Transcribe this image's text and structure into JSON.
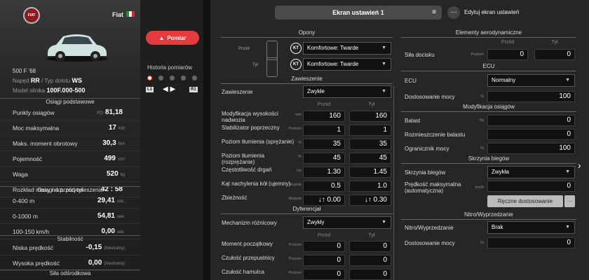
{
  "brand": "Fiat",
  "logo_text": "FIAT",
  "model": "500 F '68",
  "drive_label": "Napęd",
  "drive": "RR",
  "aspiration_label": "Typ dolotu",
  "aspiration": "WS",
  "engine_label": "Model silnika",
  "engine": "100F.000-500",
  "colors": {
    "accent": "#e23c3c",
    "flag_green": "#1e8f3a",
    "flag_white": "#f2f2f2",
    "flag_red": "#d7262e"
  },
  "sections": {
    "basic": "Osiągi podstawowe",
    "accel": "Osiągi dot. przyspieszenia",
    "stability": "Stabilność",
    "cornering": "Siła odśrodkowa"
  },
  "stats": [
    {
      "label": "Punkty osiągów",
      "prefix": "PO",
      "value": "81,18",
      "unit": "",
      "hist": "81,18"
    },
    {
      "label": "Moc maksymalna",
      "prefix": "",
      "value": "17",
      "unit": "KM",
      "hist": "17"
    },
    {
      "label": "Maks. moment obrotowy",
      "prefix": "",
      "value": "30,3",
      "unit": "Nm",
      "hist": "30,3"
    },
    {
      "label": "Pojemność",
      "prefix": "",
      "value": "499",
      "unit": "cm³",
      "hist": "499"
    },
    {
      "label": "Waga",
      "prefix": "",
      "value": "520",
      "unit": "kg",
      "hist": "520"
    },
    {
      "label": "Rozkład masy na przód-tył",
      "prefix": "",
      "value": "42 : 58",
      "unit": "",
      "hist": "42 : 58"
    }
  ],
  "accel": [
    {
      "label": "0-400 m",
      "value": "29,41",
      "unit": "sek.",
      "hist": "29,41"
    },
    {
      "label": "0-1000 m",
      "value": "54,81",
      "unit": "sek.",
      "hist": "54,81"
    },
    {
      "label": "100-150 km/h",
      "value": "0,00",
      "unit": "sek.",
      "hist": "0,00"
    }
  ],
  "stability": [
    {
      "label": "Niska prędkość",
      "value": "-0,15",
      "unit": "(Neutralny)",
      "hist": "-0,15"
    },
    {
      "label": "Wysoka prędkość",
      "value": "0,00",
      "unit": "(Neutralny)",
      "hist": "0,00"
    }
  ],
  "measure_button": "Pomiar",
  "history_label": "Historia pomiarów",
  "l1": "L1",
  "r1": "R1",
  "title": "Ekran ustawień 1",
  "edit_label": "Edytuj ekran ustawień",
  "edit_icon": "ellipsis-icon",
  "tires": {
    "header": "Opony",
    "front_label": "Przód",
    "rear_label": "Tył",
    "badge": "KT",
    "front": "Komfortowe: Twarde",
    "rear": "Komfortowe: Twarde"
  },
  "front_col": "Przód",
  "rear_col": "Tył",
  "suspension": {
    "header": "Zawieszenie",
    "label": "Zawieszenie",
    "value": "Zwykłe",
    "rows": [
      {
        "label": "Modyfikacja wysokości nadwozia",
        "unit": "mm",
        "front": "160",
        "rear": "160"
      },
      {
        "label": "Stabilizator poprzeczny",
        "unit": "Poziom",
        "front": "1",
        "rear": "1"
      },
      {
        "label": "Poziom tłumienia (sprężanie)",
        "unit": "%",
        "front": "35",
        "rear": "35"
      },
      {
        "label": "Poziom tłumienia (rozprężanie)",
        "unit": "%",
        "front": "45",
        "rear": "45"
      },
      {
        "label": "Częstotliwość drgań",
        "unit": "Hz",
        "front": "1.30",
        "rear": "1.45"
      },
      {
        "label": "Kąt nachylenia kół (ujemny)",
        "unit": "Stopnie",
        "front": "0.5",
        "rear": "1.0"
      },
      {
        "label": "Zbieżność",
        "unit": "Stopnie",
        "front": "↓↑ 0.00",
        "rear": "↓↑ 0.30"
      }
    ]
  },
  "diff": {
    "header": "Dyferencjał",
    "label": "Mechanizm różnicowy",
    "value": "Zwykły",
    "rows": [
      {
        "label": "Moment początkowy",
        "unit": "Poziom",
        "front": "0",
        "rear": "0"
      },
      {
        "label": "Czułość przepustnicy",
        "unit": "Poziom",
        "front": "0",
        "rear": "0"
      },
      {
        "label": "Czułość hamulca",
        "unit": "Poziom",
        "front": "0",
        "rear": "0"
      }
    ]
  },
  "aero": {
    "header": "Elementy aerodynamiczne",
    "label": "Siła docisku",
    "unit": "Poziom",
    "front": "0",
    "rear": "0"
  },
  "ecu": {
    "header": "ECU",
    "label": "ECU",
    "value": "Normalny",
    "power_label": "Dostosowanie mocy",
    "power_unit": "%",
    "power": "100"
  },
  "perf": {
    "header": "Modyfikacja osiągów",
    "ballast_label": "Balast",
    "ballast_unit": "kg",
    "ballast": "0",
    "pos_label": "Rozmieszczenie balastu",
    "pos": "0",
    "limit_label": "Ogranicznik mocy",
    "limit_unit": "%",
    "limit": "100"
  },
  "gearbox": {
    "header": "Skrzynia biegów",
    "label": "Skrzynia biegów",
    "value": "Zwykła",
    "top_label": "Prędkość maksymalna (automatyczna)",
    "top_unit": "km/h",
    "top": "0",
    "manual": "Ręczne dostosowanie"
  },
  "nitro": {
    "header": "Nitro/Wyprzedzanie",
    "label": "Nitro/Wyprzedzanie",
    "value": "Brak",
    "power_label": "Dostosowanie mocy",
    "power_unit": "%",
    "power": "0"
  }
}
